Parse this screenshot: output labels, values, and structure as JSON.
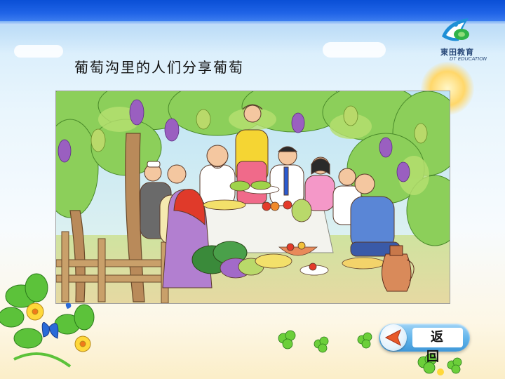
{
  "header": {
    "title": "葡萄沟里的人们分享葡萄"
  },
  "logo": {
    "name_cn": "東田教育",
    "name_en": "DT EDUCATION"
  },
  "illustration": {
    "icon": "picnic-illustration"
  },
  "navigation": {
    "return_label": "返 回"
  },
  "colors": {
    "top_bar": "#1f63e6",
    "return_button": "#5fb3ea",
    "arrow": "#e85a2a"
  }
}
